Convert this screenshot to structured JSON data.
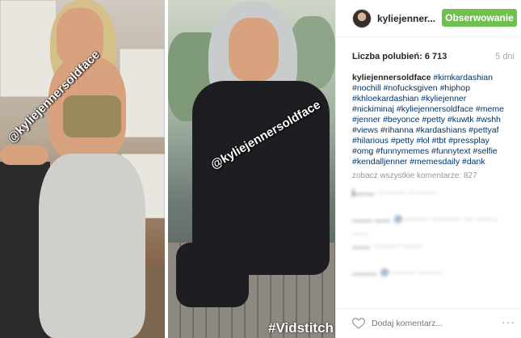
{
  "media": {
    "left_overlay": "@kyliejennersoldface",
    "right_overlay": "@kyliejennersoldface",
    "watermark": "#Vidstitch"
  },
  "header": {
    "username": "kyliejenner...",
    "follow_label": "Obserwowanie",
    "follow_color": "#70c050"
  },
  "post": {
    "likes": "Liczba polubień: 6 713",
    "age": "5 dni",
    "caption_user": "kyliejennersoldface",
    "caption_tags": "#kimkardashian #nochill #nofucksgiven #hiphop #khloekardashian #kyliejenner #nickiminaj #kyliejennersoldface #meme #jenner #beyonce #petty #kuwtk #wshh #views #rihanna #kardashians #pettyaf #hilarious #petty #lol #tbt #pressplay #omg #funnymemes #funnytext #selfie #kendalljenner #memesdaily #dank",
    "view_all": "zobacz wszystkie komentarze: 827"
  },
  "comments": [
    {
      "user": "j.........",
      "text": "·········· ···········"
    },
    {
      "user": "......... .......",
      "text": "@·········· ··········· ···· ········ ······"
    },
    {
      "user": "........",
      "text": "·········· ·······"
    },
    {
      "user": "...........",
      "text": "@·········· ·········"
    }
  ],
  "footer": {
    "heart_icon": "heart-outline-icon",
    "comment_placeholder": "Dodaj komentarz...",
    "more_label": "···"
  }
}
